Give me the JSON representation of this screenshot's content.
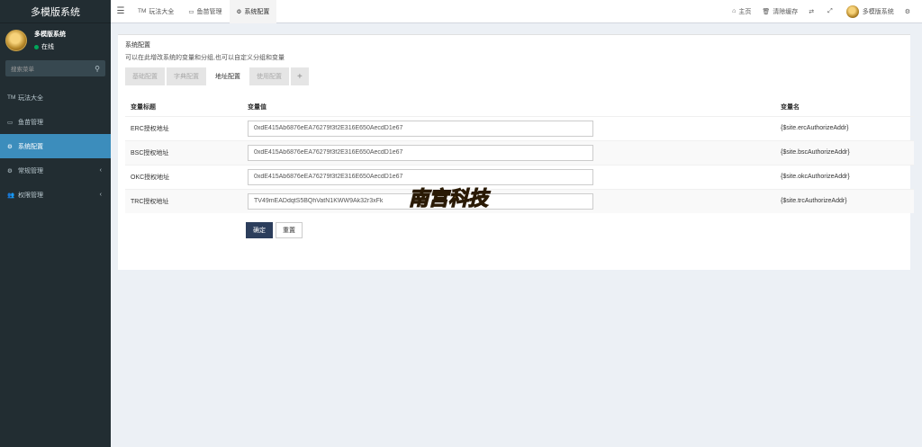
{
  "app": {
    "title": "多模版系统"
  },
  "user": {
    "name": "多模版系统",
    "status": "在线"
  },
  "sidebar": {
    "search_placeholder": "搜索菜单",
    "items": [
      {
        "icon": "TM",
        "label": "玩法大全"
      },
      {
        "icon": "▭",
        "label": "鱼苗管理"
      },
      {
        "icon": "⚙",
        "label": "系统配置"
      },
      {
        "icon": "⚙",
        "label": "常规管理"
      },
      {
        "icon": "👥",
        "label": "权限管理"
      }
    ]
  },
  "topbar": {
    "tabs": [
      {
        "icon": "TM",
        "label": "玩法大全"
      },
      {
        "icon": "▭",
        "label": "鱼苗管理"
      },
      {
        "icon": "⚙",
        "label": "系统配置"
      }
    ],
    "right": {
      "home": "主页",
      "clear_cache": "清除缓存",
      "user": "多模版系统"
    }
  },
  "panel": {
    "title": "系统配置",
    "subtitle": "可以在此增改系统的变量和分组,也可以自定义分组和变量",
    "tabs": [
      "基础配置",
      "字典配置",
      "地址配置",
      "使用配置"
    ],
    "plus": "+",
    "columns": [
      "变量标题",
      "变量值",
      "变量名"
    ],
    "rows": [
      {
        "title": "ERC授权地址",
        "value": "0xdE415Ab6876eEA76279f3f2E316E650AecdD1e67",
        "name": "{$site.ercAuthorizeAddr}"
      },
      {
        "title": "BSC授权地址",
        "value": "0xdE415Ab6876eEA76279f3f2E316E650AecdD1e67",
        "name": "{$site.bscAuthorizeAddr}"
      },
      {
        "title": "OKC授权地址",
        "value": "0xdE415Ab6876eEA76279f3f2E316E650AecdD1e67",
        "name": "{$site.okcAuthorizeAddr}"
      },
      {
        "title": "TRC授权地址",
        "value": "TV49mEADdqtS5BQhVatN1KWW9Ak32r3xFk",
        "name": "{$site.trcAuthorizeAddr}"
      }
    ],
    "buttons": {
      "ok": "确定",
      "reset": "重置"
    }
  },
  "watermark": {
    "text": "南宫科技"
  }
}
